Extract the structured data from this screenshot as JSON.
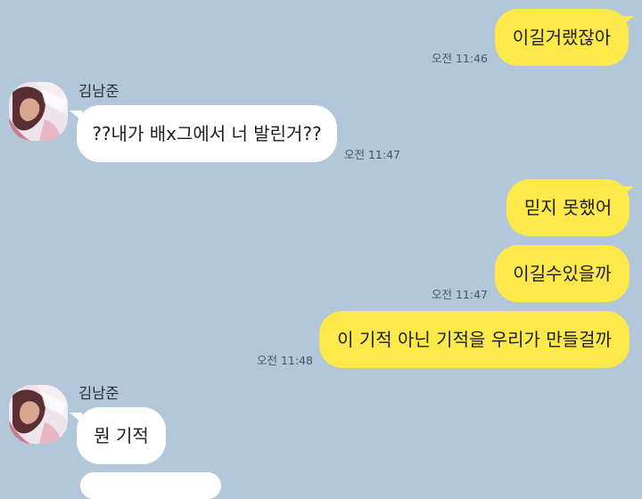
{
  "chat": {
    "messages": [
      {
        "id": "m1",
        "sender": "me",
        "text": "이길거랬잖아",
        "time": "오전 11:46"
      },
      {
        "id": "m2",
        "sender": "김남준",
        "text": "??내가 배x그에서 너 발린거??",
        "time": "오전 11:47"
      },
      {
        "id": "m3",
        "sender": "me",
        "text": "믿지 못했어"
      },
      {
        "id": "m4",
        "sender": "me",
        "text": "이길수있을까",
        "time": "오전 11:47"
      },
      {
        "id": "m5",
        "sender": "me",
        "text": "이 기적 아닌 기적을 우리가 만들걸까",
        "time": "오전 11:48"
      },
      {
        "id": "m6",
        "sender": "김남준",
        "text": "뭔 기적"
      }
    ],
    "contact": {
      "name": "김남준"
    }
  },
  "colors": {
    "background": "#b2c7da",
    "my_bubble": "#fee94b",
    "other_bubble": "#ffffff"
  },
  "icons": {
    "avatar": "profile-photo"
  }
}
